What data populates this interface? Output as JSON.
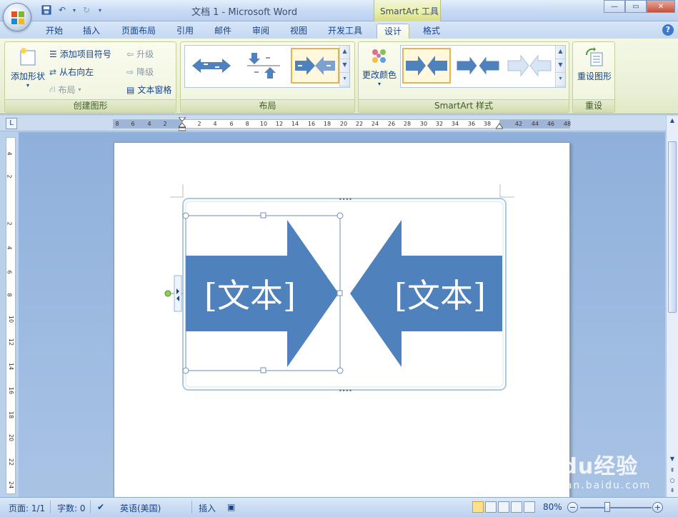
{
  "window": {
    "title": "文档 1 - Microsoft Word",
    "context_tab": "SmartArt 工具"
  },
  "tabs": [
    "开始",
    "插入",
    "页面布局",
    "引用",
    "邮件",
    "审阅",
    "视图",
    "开发工具",
    "设计",
    "格式"
  ],
  "active_tab": "设计",
  "ribbon": {
    "create_group": {
      "label": "创建图形",
      "add_shape": "添加形状",
      "add_bullet": "添加项目符号",
      "right_to_left": "从右向左",
      "layout": "布局",
      "promote": "升级",
      "demote": "降级",
      "text_pane": "文本窗格"
    },
    "layout_group": {
      "label": "布局"
    },
    "style_group": {
      "label": "SmartArt 样式",
      "change_colors": "更改颜色"
    },
    "reset_group": {
      "label": "重设",
      "reset_graphic": "重设图形"
    }
  },
  "ruler": {
    "marks": [
      "8",
      "6",
      "4",
      "2",
      "2",
      "4",
      "6",
      "8",
      "10",
      "12",
      "14",
      "16",
      "18",
      "20",
      "22",
      "24",
      "26",
      "28",
      "30",
      "32",
      "34",
      "36",
      "38",
      "42",
      "44",
      "46",
      "48"
    ],
    "vmarks": [
      "4",
      "2",
      "2",
      "4",
      "6",
      "8",
      "10",
      "12",
      "14",
      "16",
      "18",
      "20",
      "22",
      "24"
    ]
  },
  "smartart": {
    "left_text": "[文本]",
    "right_text": "[文本]"
  },
  "status": {
    "page": "页面: 1/1",
    "words": "字数: 0",
    "language": "英语(美国)",
    "insert": "插入",
    "zoom": "80%"
  },
  "watermark": {
    "main": "Baidu经验",
    "sub": "jingyan.baidu.com"
  },
  "colors": {
    "arrow_fill": "#4f81bd",
    "ribbon_bg": "#eef3dc",
    "workspace": "#9cb9e0"
  }
}
